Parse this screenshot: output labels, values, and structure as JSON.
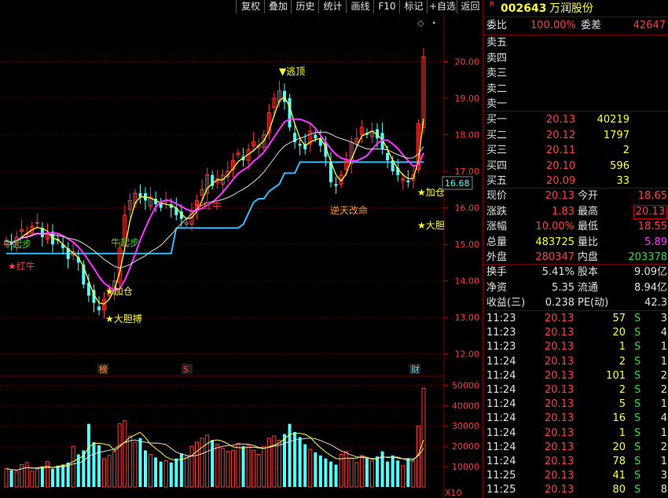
{
  "toolbar": {
    "items": [
      "复权",
      "叠加",
      "历史",
      "统计",
      "画线",
      "F10",
      "标记",
      "+自选",
      "返回"
    ]
  },
  "stock": {
    "flag": "R",
    "code": "002643",
    "name": "万润股份"
  },
  "chart_data": {
    "type": "candlestick",
    "price_axis": {
      "ticks": [
        "20.00",
        "19.00",
        "18.00",
        "17.00",
        "16.00",
        "15.00",
        "14.00",
        "13.00",
        "12.00"
      ],
      "ylim": [
        11.5,
        21.3
      ]
    },
    "current_price_label": "16.68",
    "volume_axis": {
      "ticks": [
        "50000",
        "40000",
        "30000",
        "20000",
        "10000"
      ],
      "ylim": [
        0,
        54000
      ],
      "multiplier": "X10"
    },
    "annotations": {
      "escape_top": "▼逃顶",
      "add_pos_1": "★加仓",
      "add_pos_2": "★加仓",
      "bold_1": "★大胆搏",
      "bold_2": "★大胆",
      "reversal": "逆天改命",
      "red_1": "★红牛",
      "red_2": "★红牛",
      "cow_1": "牛起步",
      "cow_2": "牛起步"
    },
    "markers": {
      "bang": "榜",
      "s": "S",
      "cai": "财"
    },
    "closes": [
      15.1,
      15.0,
      15.2,
      15.4,
      15.3,
      15.5,
      15.6,
      15.2,
      15.3,
      15.0,
      15.1,
      14.9,
      14.6,
      14.8,
      14.5,
      13.9,
      13.6,
      13.4,
      13.2,
      13.5,
      13.8,
      14.0,
      14.9,
      15.8,
      16.2,
      16.4,
      16.3,
      16.2,
      16.3,
      16.1,
      16.0,
      16.2,
      16.0,
      15.8,
      15.7,
      15.6,
      15.9,
      16.2,
      16.5,
      16.9,
      16.6,
      16.8,
      16.9,
      17.0,
      17.3,
      17.5,
      17.3,
      17.6,
      17.8,
      17.7,
      18.0,
      18.6,
      19.0,
      19.2,
      18.9,
      18.2,
      17.8,
      17.7,
      17.6,
      18.1,
      17.9,
      17.7,
      17.4,
      16.7,
      16.6,
      16.9,
      17.3,
      17.8,
      17.9,
      18.2,
      18.0,
      18.1,
      17.9,
      17.6,
      17.3,
      17.0,
      16.9,
      16.8,
      16.7,
      16.9,
      18.3,
      20.13
    ],
    "volumes": [
      9000,
      8200,
      7600,
      11000,
      12000,
      7800,
      8600,
      10000,
      12500,
      9000,
      10500,
      11000,
      12000,
      20000,
      16000,
      18000,
      31000,
      22000,
      20500,
      14000,
      15500,
      17500,
      31000,
      32500,
      25000,
      22000,
      24000,
      18000,
      16000,
      14500,
      12500,
      13000,
      12000,
      14000,
      16500,
      15000,
      20000,
      22000,
      24000,
      25500,
      23000,
      21000,
      19000,
      17500,
      18000,
      21500,
      20000,
      20500,
      18000,
      16000,
      20000,
      24000,
      25000,
      23000,
      26000,
      31000,
      27000,
      24500,
      21000,
      18500,
      17000,
      15500,
      14000,
      12500,
      11000,
      16000,
      17500,
      14000,
      12000,
      15500,
      14000,
      13000,
      15000,
      17500,
      12500,
      15500,
      13000,
      10500,
      14000,
      12500,
      30000,
      48500
    ]
  },
  "quote": {
    "weibi_label": "委比",
    "weibi_value": "100.00%",
    "weicha_label": "委差",
    "weicha_value": "42647",
    "asks": [
      {
        "label": "卖五"
      },
      {
        "label": "卖四"
      },
      {
        "label": "卖三"
      },
      {
        "label": "卖二"
      },
      {
        "label": "卖一"
      }
    ],
    "bids": [
      {
        "label": "买一",
        "price": "20.13",
        "vol": "40219"
      },
      {
        "label": "买二",
        "price": "20.12",
        "vol": "1797"
      },
      {
        "label": "买三",
        "price": "20.11",
        "vol": "2"
      },
      {
        "label": "买四",
        "price": "20.10",
        "vol": "596"
      },
      {
        "label": "买五",
        "price": "20.09",
        "vol": "33"
      }
    ],
    "stats": [
      {
        "l1": "现价",
        "v1": "20.13",
        "l2": "今开",
        "v2": "18.65"
      },
      {
        "l1": "涨跌",
        "v1": "1.83",
        "l2": "最高",
        "v2": "20.13"
      },
      {
        "l1": "涨幅",
        "v1": "10.00%",
        "l2": "最低",
        "v2": "18.55"
      },
      {
        "l1": "总量",
        "v1": "483725",
        "l2": "量比",
        "v2": "5.89"
      },
      {
        "l1": "外盘",
        "v1": "280347",
        "l2": "内盘",
        "v2": "203378"
      }
    ],
    "fund": [
      {
        "l1": "换手",
        "v1": "5.41%",
        "l2": "股本",
        "v2": "9.09亿"
      },
      {
        "l1": "净资",
        "v1": "5.35",
        "l2": "流通",
        "v2": "8.94亿"
      },
      {
        "l1": "收益(三)",
        "v1": "0.238",
        "l2": "PE(动)",
        "v2": "42.3"
      }
    ]
  },
  "ticks": [
    {
      "time": "11:23",
      "price": "20.13",
      "vol": "57",
      "dir": "S",
      "n": "3"
    },
    {
      "time": "11:23",
      "price": "20.13",
      "vol": "20",
      "dir": "S",
      "n": "4"
    },
    {
      "time": "11:23",
      "price": "20.13",
      "vol": "1",
      "dir": "S",
      "n": "1"
    },
    {
      "time": "11:24",
      "price": "20.13",
      "vol": "2",
      "dir": "S",
      "n": "1"
    },
    {
      "time": "11:24",
      "price": "20.13",
      "vol": "101",
      "dir": "S",
      "n": "2"
    },
    {
      "time": "11:24",
      "price": "20.13",
      "vol": "2",
      "dir": "S",
      "n": "2"
    },
    {
      "time": "11:24",
      "price": "20.13",
      "vol": "5",
      "dir": "S",
      "n": "1"
    },
    {
      "time": "11:24",
      "price": "20.13",
      "vol": "16",
      "dir": "S",
      "n": "4"
    },
    {
      "time": "11:24",
      "price": "20.13",
      "vol": "1",
      "dir": "S",
      "n": "1"
    },
    {
      "time": "11:24",
      "price": "20.13",
      "vol": "20",
      "dir": "S",
      "n": "2"
    },
    {
      "time": "11:24",
      "price": "20.13",
      "vol": "78",
      "dir": "S",
      "n": "1"
    },
    {
      "time": "11:25",
      "price": "20.13",
      "vol": "41",
      "dir": "S",
      "n": "3"
    },
    {
      "time": "11:25",
      "price": "20.13",
      "vol": "80",
      "dir": "S",
      "n": "8"
    }
  ]
}
